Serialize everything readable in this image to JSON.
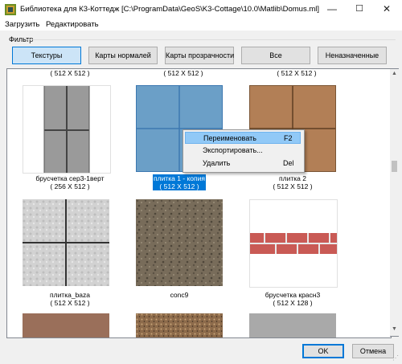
{
  "window": {
    "title": "Библиотека для К3-Коттедж [C:\\ProgramData\\GeoS\\K3-Cottage\\10.0\\Matlib\\Domus.ml]",
    "minimize": "—",
    "maximize": "☐",
    "close": "✕"
  },
  "menu": {
    "load": "Загрузить",
    "edit": "Редактировать"
  },
  "filter": {
    "label": "Фильтр",
    "buttons": [
      "Текстуры",
      "Карты нормалей",
      "Карты прозрачности",
      "Все",
      "Неназначенные"
    ],
    "selected": "Текстуры"
  },
  "list": {
    "top_row_sizes": [
      "( 512 X 512 )",
      "( 512 X 512 )",
      "( 512 X 512 )"
    ],
    "items": [
      {
        "name": "брусчетка сер3-1верт",
        "size": "( 256 X 512 )"
      },
      {
        "name": "плитка 1 - копия",
        "size": "( 512 X 512 )",
        "selected": true
      },
      {
        "name": "плитка 2",
        "size": "( 512 X 512 )"
      },
      {
        "name": "плитка_baza",
        "size": "( 512 X 512 )"
      },
      {
        "name": "conc9",
        "size": "( 512 X 512 )"
      },
      {
        "name": "брусчетка красн3",
        "size": "( 512 X 128 )"
      }
    ]
  },
  "context_menu": {
    "items": [
      {
        "label": "Переименовать",
        "shortcut": "F2"
      },
      {
        "label": "Экспортировать...",
        "shortcut": ""
      },
      {
        "label": "Удалить",
        "shortcut": "Del"
      }
    ]
  },
  "footer": {
    "ok": "OK",
    "cancel": "Отмена"
  },
  "colors": {
    "selection": "#0078d7",
    "menu_highlight": "#91c9f7",
    "active_button": "#cce4f7"
  }
}
